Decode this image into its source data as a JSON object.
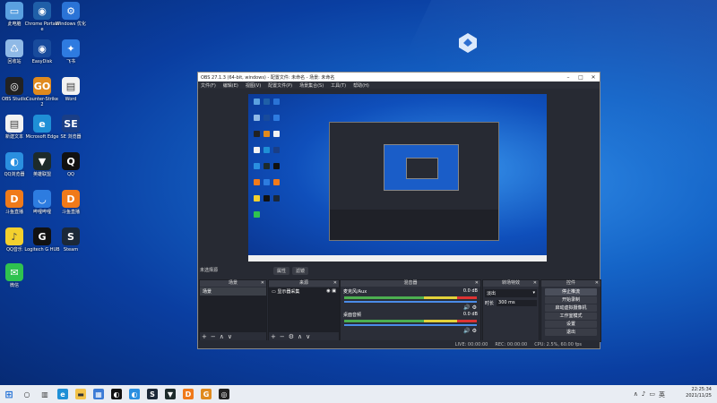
{
  "desktop": {
    "icons": [
      {
        "label": "此电脑",
        "icon": "computer-icon",
        "color": "#5aa0e0",
        "glyph": "▭"
      },
      {
        "label": "Chrome Portable",
        "icon": "chrome-circle-icon",
        "color": "#1f5fa8",
        "glyph": "◉"
      },
      {
        "label": "Windows 优化",
        "icon": "settings-app-icon",
        "color": "#2a73d6",
        "glyph": "⚙"
      },
      {
        "label": "回收站",
        "icon": "recycle-bin-icon",
        "color": "#8fb9e6",
        "glyph": "♺"
      },
      {
        "label": "EasyDisk",
        "icon": "disk-app-icon",
        "color": "#184b9c",
        "glyph": "◉"
      },
      {
        "label": "飞书",
        "icon": "bird-app-icon",
        "color": "#2e7be0",
        "glyph": "✦"
      },
      {
        "label": "OBS Studio",
        "icon": "obs-icon",
        "color": "#222222",
        "glyph": "◎"
      },
      {
        "label": "Counter-Strike 2",
        "icon": "cs-icon",
        "color": "#e08a1e",
        "glyph": "GO"
      },
      {
        "label": "Word",
        "icon": "document-icon",
        "color": "#f2f2f2",
        "glyph": "▤"
      },
      {
        "label": "新建文本",
        "icon": "text-file-icon",
        "color": "#f2f2f2",
        "glyph": "▤"
      },
      {
        "label": "Microsoft Edge",
        "icon": "edge-icon",
        "color": "#1f8fd6",
        "glyph": "e"
      },
      {
        "label": "SE 浏览器",
        "icon": "se-browser-icon",
        "color": "#1a3e86",
        "glyph": "SE"
      },
      {
        "label": "QQ浏览器",
        "icon": "qq-browser-icon",
        "color": "#2a8fe0",
        "glyph": "◐"
      },
      {
        "label": "英雄联盟",
        "icon": "lol-icon",
        "color": "#1d2b2b",
        "glyph": "▼"
      },
      {
        "label": "QQ",
        "icon": "qq-icon",
        "color": "#111111",
        "glyph": "Q"
      },
      {
        "label": "斗鱼直播",
        "icon": "douyu-icon",
        "color": "#f07a1a",
        "glyph": "D"
      },
      {
        "label": "哔哩哔哩",
        "icon": "bilibili-icon",
        "color": "#2d7ce0",
        "glyph": "◡"
      },
      {
        "label": "斗鱼直播",
        "icon": "douyu-icon",
        "color": "#f07a1a",
        "glyph": "D"
      },
      {
        "label": "QQ音乐",
        "icon": "qq-music-icon",
        "color": "#f3d02e",
        "glyph": "♪"
      },
      {
        "label": "Logitech G HUB",
        "icon": "logitech-icon",
        "color": "#111111",
        "glyph": "G"
      },
      {
        "label": "Steam",
        "icon": "steam-icon",
        "color": "#1b2838",
        "glyph": "S"
      },
      {
        "label": "微信",
        "icon": "wechat-icon",
        "color": "#2fc24f",
        "glyph": "✉"
      }
    ]
  },
  "obs": {
    "title": "OBS 27.1.3 (64-bit, windows) - 配置文件: 未命名 - 场景: 未命名",
    "menu": [
      "文件(F)",
      "编辑(E)",
      "视图(V)",
      "配置文件(P)",
      "场景集合(S)",
      "工具(T)",
      "帮助(H)"
    ],
    "scene_label": "未选择源",
    "preview_tabs": [
      "属性",
      "滤镜"
    ],
    "docks": {
      "scenes": {
        "title": "场景",
        "items": [
          "场景"
        ]
      },
      "sources": {
        "title": "来源",
        "items": [
          "显示器采集"
        ]
      },
      "mixer": {
        "title": "混音器",
        "channels": [
          {
            "name": "麦克风/Aux",
            "db": "0.0 dB"
          },
          {
            "name": "桌面音频",
            "db": "0.0 dB"
          }
        ]
      },
      "transitions": {
        "title": "转场特效",
        "type": "淡出",
        "duration_label": "时长",
        "duration": "300 ms"
      },
      "controls": {
        "title": "控件",
        "buttons": [
          "停止推流",
          "开始录制",
          "启动虚拟摄像机",
          "工作室模式",
          "设置",
          "退出"
        ]
      }
    },
    "status": {
      "live": "LIVE: 00:00:00",
      "rec": "REC: 00:00:00",
      "cpu": "CPU: 2.5%, 60.00 fps"
    }
  },
  "taskbar": {
    "time": "22:25:34",
    "date": "2021/11/25",
    "apps": [
      {
        "icon": "search-icon",
        "color": "#e9edf3",
        "glyph": "○"
      },
      {
        "icon": "task-view-icon",
        "color": "#e9edf3",
        "glyph": "▥"
      },
      {
        "icon": "edge-icon",
        "color": "#1f8fd6",
        "glyph": "e"
      },
      {
        "icon": "file-explorer-icon",
        "color": "#f3c34a",
        "glyph": "▬"
      },
      {
        "icon": "store-icon",
        "color": "#3b7bd6",
        "glyph": "▦"
      },
      {
        "icon": "app-icon",
        "color": "#111111",
        "glyph": "◐"
      },
      {
        "icon": "qq-browser-icon",
        "color": "#2a8fe0",
        "glyph": "◐"
      },
      {
        "icon": "steam-icon",
        "color": "#1b2838",
        "glyph": "S"
      },
      {
        "icon": "lol-icon",
        "color": "#1d2b2b",
        "glyph": "▼"
      },
      {
        "icon": "douyu-icon",
        "color": "#f07a1a",
        "glyph": "D"
      },
      {
        "icon": "cs-icon",
        "color": "#e08a1e",
        "glyph": "G"
      },
      {
        "icon": "obs-icon",
        "color": "#222222",
        "glyph": "◎"
      }
    ],
    "tray": [
      "∧",
      "♪",
      "▭",
      "英"
    ]
  }
}
